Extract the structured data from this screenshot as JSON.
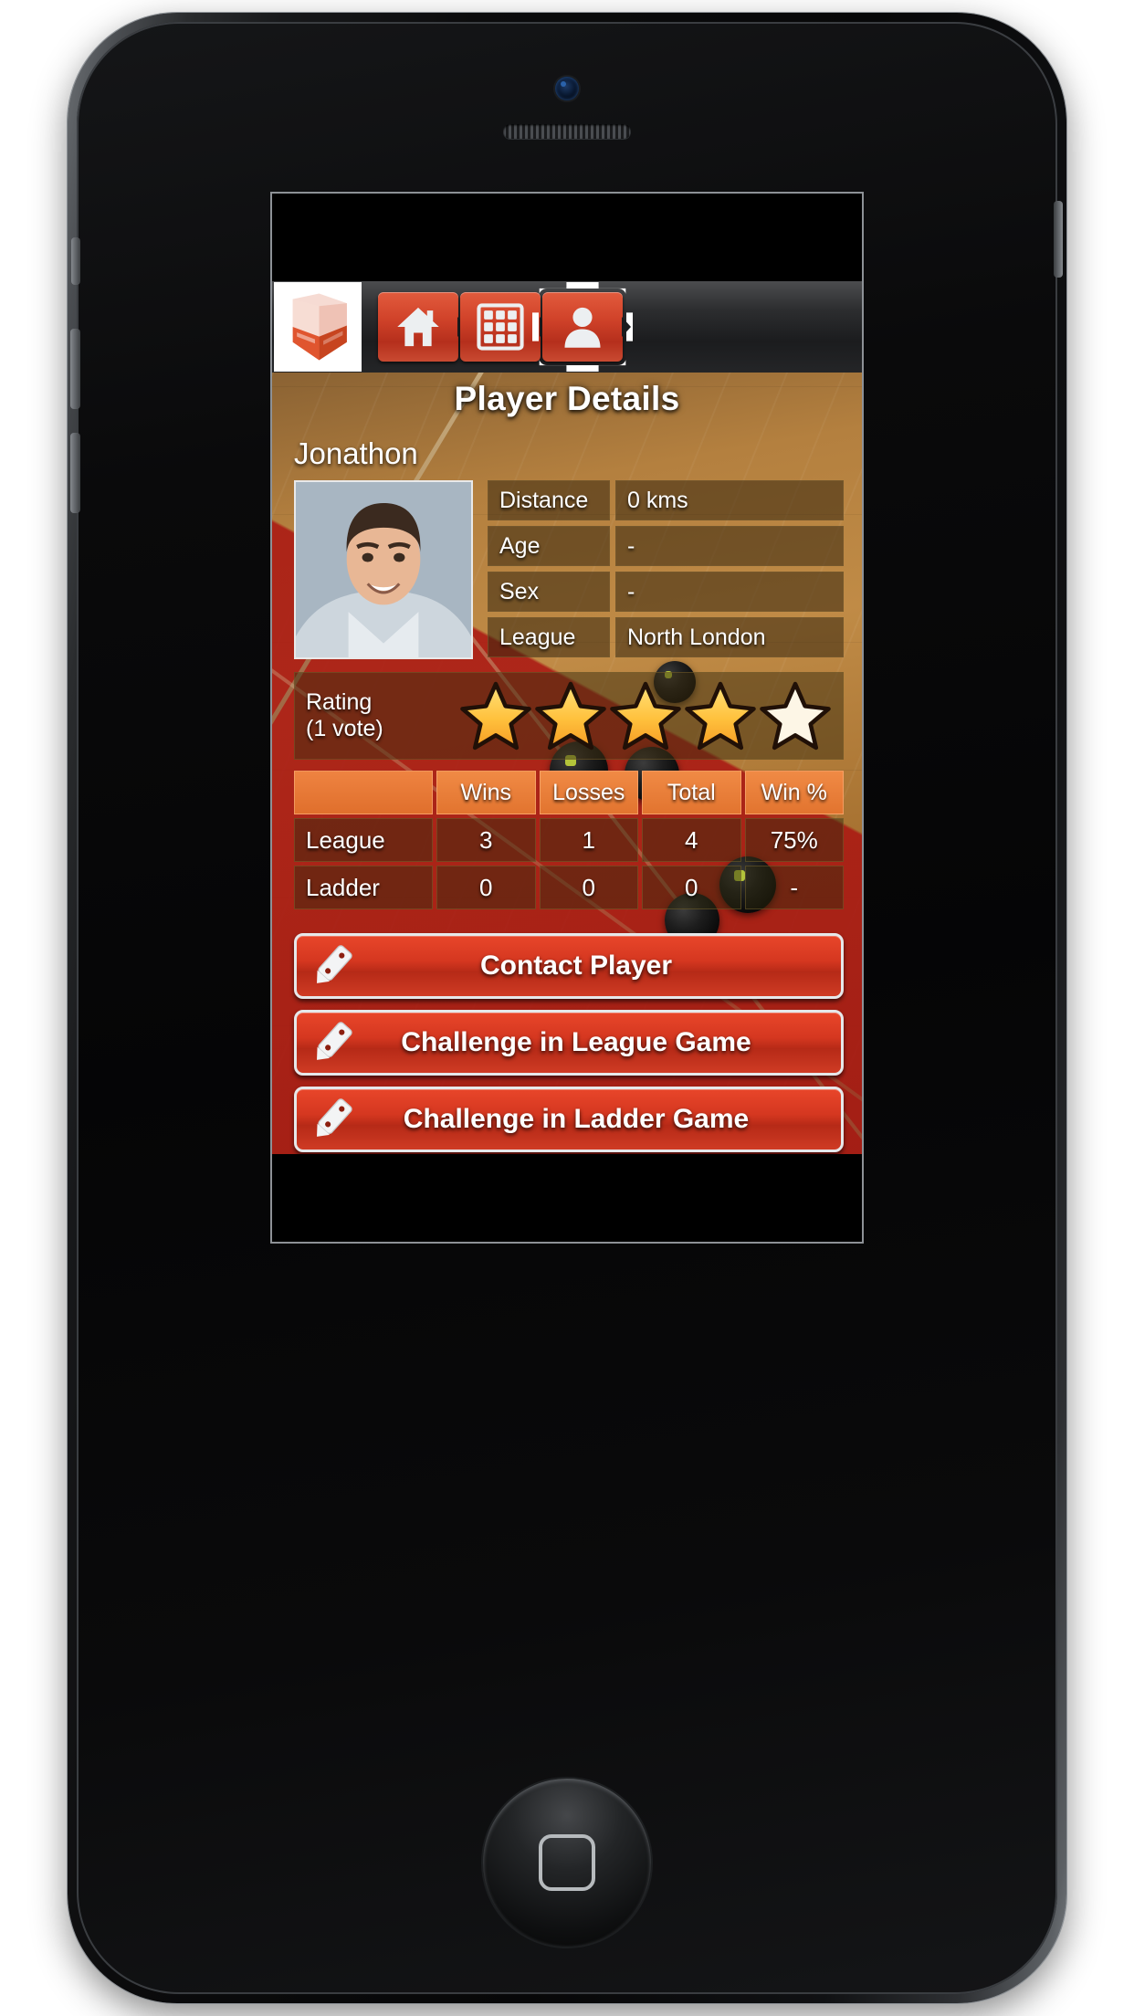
{
  "app": {
    "logo_icon": "squash-court-logo-icon"
  },
  "toolbar": {
    "tabs": [
      {
        "name": "home",
        "icon": "home-icon",
        "selected": false
      },
      {
        "name": "grid",
        "icon": "grid-icon",
        "selected": false
      },
      {
        "name": "profile",
        "icon": "person-icon",
        "selected": true
      }
    ]
  },
  "page": {
    "title": "Player Details",
    "player_name": "Jonathon",
    "avatar_icon": "player-photo"
  },
  "info": {
    "rows": [
      {
        "key": "Distance",
        "value": "0 kms"
      },
      {
        "key": "Age",
        "value": "-"
      },
      {
        "key": "Sex",
        "value": "-"
      },
      {
        "key": "League",
        "value": "North London"
      }
    ]
  },
  "rating": {
    "label_line1": "Rating",
    "label_line2": "(1 vote)",
    "stars_filled": 4,
    "stars_total": 5,
    "star_fill_color": "#ffc13d",
    "star_empty_color": "#fdf6e6"
  },
  "stats": {
    "headers": [
      "",
      "Wins",
      "Losses",
      "Total",
      "Win %"
    ],
    "rows": [
      {
        "label": "League",
        "wins": "3",
        "losses": "1",
        "total": "4",
        "win_pct": "75%"
      },
      {
        "label": "Ladder",
        "wins": "0",
        "losses": "0",
        "total": "0",
        "win_pct": "-"
      }
    ]
  },
  "actions": [
    {
      "label": "Contact Player",
      "icon": "pencil-icon"
    },
    {
      "label": "Challenge in League Game",
      "icon": "pencil-icon"
    },
    {
      "label": "Challenge in Ladder Game",
      "icon": "pencil-icon"
    }
  ],
  "colors": {
    "accent_red": "#d53720",
    "header_orange": "#e2742f",
    "court_wood": "#b4803f",
    "band_red": "#aa1612"
  }
}
